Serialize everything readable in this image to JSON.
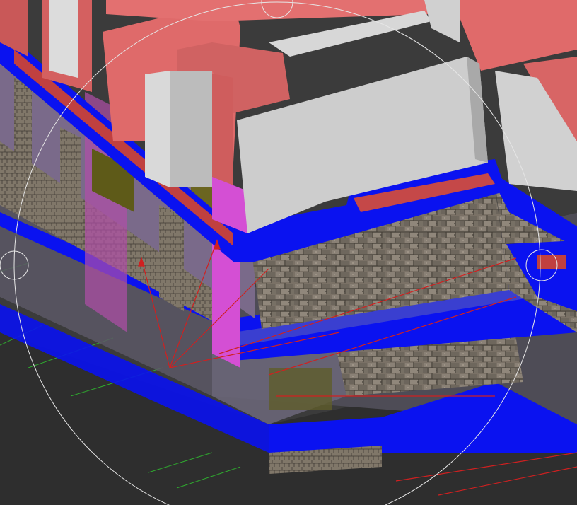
{
  "viewport": {
    "kind": "3D CAD model viewport (orbit mode)",
    "background": "#3a3a3a",
    "visual_style": "shaded with textures"
  },
  "colors": {
    "slab_edge": "#0a12f0",
    "interior_wall": "#de6666",
    "parapet_wall": "#cfcfcf",
    "ground_grid_green": "#2fa82f",
    "axis_red": "#d02020",
    "stone_cladding": "#7d7468",
    "glass_tint": "#6a6474",
    "column_magenta": "#d44fd4"
  },
  "orbit_tool": {
    "active": true,
    "icon": "orbit-arcball-circle"
  },
  "ucs_icon": {
    "icon": "ucs-red-axis"
  }
}
